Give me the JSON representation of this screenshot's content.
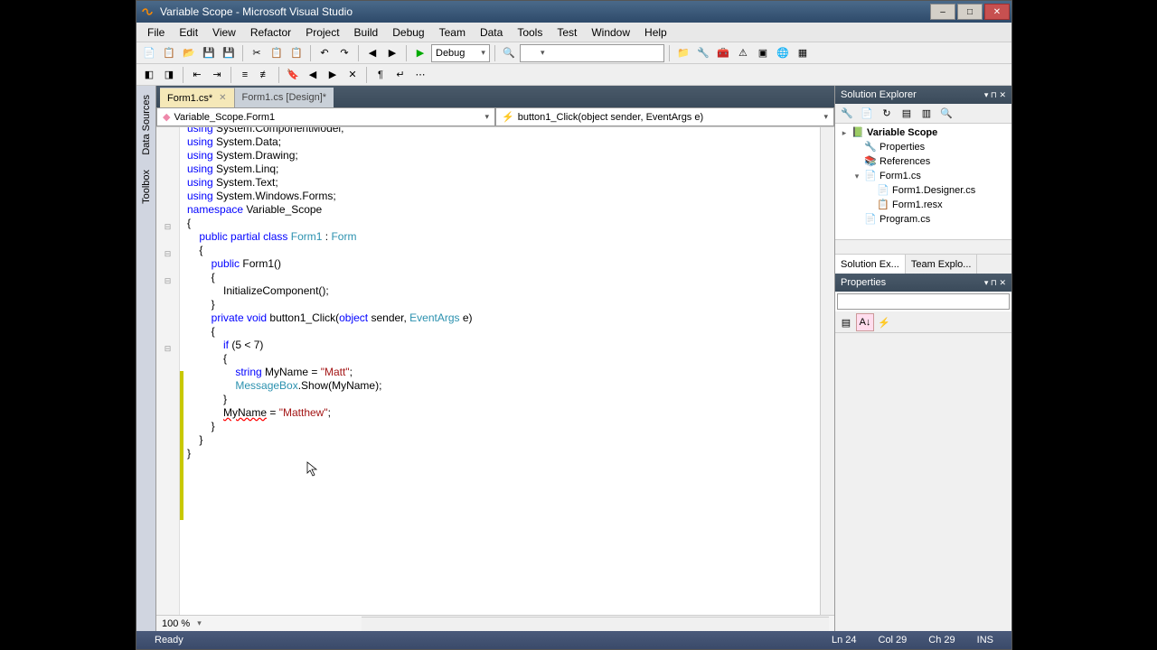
{
  "titlebar": {
    "app_icon": "∞",
    "title": "Variable Scope - Microsoft Visual Studio"
  },
  "menu": [
    "File",
    "Edit",
    "View",
    "Refactor",
    "Project",
    "Build",
    "Debug",
    "Team",
    "Data",
    "Tools",
    "Test",
    "Window",
    "Help"
  ],
  "toolbar1_config": "Debug",
  "tabs": [
    {
      "label": "Form1.cs*",
      "active": true
    },
    {
      "label": "Form1.cs [Design]*",
      "active": false
    }
  ],
  "combo_left": "Variable_Scope.Form1",
  "combo_right": "button1_Click(object sender, EventArgs e)",
  "code_lines": [
    {
      "i": 0,
      "t": [
        [
          "k",
          "using"
        ],
        [
          "",
          " System.ComponentModel;"
        ]
      ],
      "clip": true
    },
    {
      "i": 0,
      "t": [
        [
          "k",
          "using"
        ],
        [
          "",
          " System.Data;"
        ]
      ]
    },
    {
      "i": 0,
      "t": [
        [
          "k",
          "using"
        ],
        [
          "",
          " System.Drawing;"
        ]
      ]
    },
    {
      "i": 0,
      "t": [
        [
          "k",
          "using"
        ],
        [
          "",
          " System.Linq;"
        ]
      ]
    },
    {
      "i": 0,
      "t": [
        [
          "k",
          "using"
        ],
        [
          "",
          " System.Text;"
        ]
      ]
    },
    {
      "i": 0,
      "t": [
        [
          "k",
          "using"
        ],
        [
          "",
          " System.Windows.Forms;"
        ]
      ]
    },
    {
      "i": 0,
      "t": [
        [
          "",
          ""
        ]
      ]
    },
    {
      "i": 0,
      "t": [
        [
          "k",
          "namespace"
        ],
        [
          "",
          " Variable_Scope"
        ]
      ],
      "fold": "-"
    },
    {
      "i": 0,
      "t": [
        [
          "",
          "{"
        ]
      ]
    },
    {
      "i": 1,
      "t": [
        [
          "k",
          "public"
        ],
        [
          "",
          " "
        ],
        [
          "k",
          "partial"
        ],
        [
          "",
          " "
        ],
        [
          "k",
          "class"
        ],
        [
          "",
          " "
        ],
        [
          "t",
          "Form1"
        ],
        [
          "",
          " : "
        ],
        [
          "t",
          "Form"
        ]
      ],
      "fold": "-"
    },
    {
      "i": 1,
      "t": [
        [
          "",
          "{"
        ]
      ]
    },
    {
      "i": 2,
      "t": [
        [
          "k",
          "public"
        ],
        [
          "",
          " Form1()"
        ]
      ],
      "fold": "-"
    },
    {
      "i": 2,
      "t": [
        [
          "",
          "{"
        ]
      ]
    },
    {
      "i": 3,
      "t": [
        [
          "",
          "InitializeComponent();"
        ]
      ]
    },
    {
      "i": 2,
      "t": [
        [
          "",
          "}"
        ]
      ]
    },
    {
      "i": 0,
      "t": [
        [
          "",
          ""
        ]
      ]
    },
    {
      "i": 2,
      "t": [
        [
          "k",
          "private"
        ],
        [
          "",
          " "
        ],
        [
          "k",
          "void"
        ],
        [
          "",
          " button1_Click("
        ],
        [
          "k",
          "object"
        ],
        [
          "",
          " sender, "
        ],
        [
          "t",
          "EventArgs"
        ],
        [
          "",
          " e)"
        ]
      ],
      "fold": "-"
    },
    {
      "i": 2,
      "t": [
        [
          "",
          "{"
        ]
      ]
    },
    {
      "i": 3,
      "t": [
        [
          "k",
          "if"
        ],
        [
          "",
          " (5 < 7)"
        ]
      ],
      "ch": true
    },
    {
      "i": 3,
      "t": [
        [
          "",
          "{"
        ]
      ],
      "ch": true
    },
    {
      "i": 4,
      "t": [
        [
          "k",
          "string"
        ],
        [
          "",
          " MyName = "
        ],
        [
          "s",
          "\"Matt\""
        ],
        [
          "",
          ";"
        ]
      ],
      "ch": true
    },
    {
      "i": 4,
      "t": [
        [
          "t",
          "MessageBox"
        ],
        [
          "",
          ".Show(MyName);"
        ]
      ],
      "ch": true
    },
    {
      "i": 3,
      "t": [
        [
          "",
          "}"
        ]
      ],
      "ch": true
    },
    {
      "i": 0,
      "t": [
        [
          "",
          ""
        ]
      ],
      "ch": true
    },
    {
      "i": 3,
      "t": [
        [
          "err",
          "MyName"
        ],
        [
          "",
          " = "
        ],
        [
          "s",
          "\"Matthew\""
        ],
        [
          "",
          ";"
        ]
      ],
      "ch": true
    },
    {
      "i": 0,
      "t": [
        [
          "",
          ""
        ]
      ],
      "ch": true
    },
    {
      "i": 0,
      "t": [
        [
          "",
          ""
        ]
      ],
      "ch": true
    },
    {
      "i": 0,
      "t": [
        [
          "",
          ""
        ]
      ],
      "ch": true
    },
    {
      "i": 0,
      "t": [
        [
          "",
          ""
        ]
      ],
      "ch": true
    },
    {
      "i": 2,
      "t": [
        [
          "",
          "}"
        ]
      ]
    },
    {
      "i": 1,
      "t": [
        [
          "",
          "}"
        ]
      ]
    },
    {
      "i": 0,
      "t": [
        [
          "",
          "}"
        ]
      ]
    }
  ],
  "editor_zoom": "100 %",
  "sidebar_labels": {
    "datasources": "Data Sources",
    "toolbox": "Toolbox"
  },
  "solution_explorer": {
    "title": "Solution Explorer",
    "nodes": [
      {
        "depth": 0,
        "tw": "▸",
        "ico": "sln",
        "label": "Variable Scope",
        "bold": true
      },
      {
        "depth": 1,
        "tw": "",
        "ico": "prop",
        "label": "Properties"
      },
      {
        "depth": 1,
        "tw": "",
        "ico": "ref",
        "label": "References"
      },
      {
        "depth": 1,
        "tw": "▾",
        "ico": "cs",
        "label": "Form1.cs"
      },
      {
        "depth": 2,
        "tw": "",
        "ico": "cs",
        "label": "Form1.Designer.cs"
      },
      {
        "depth": 2,
        "tw": "",
        "ico": "rx",
        "label": "Form1.resx"
      },
      {
        "depth": 1,
        "tw": "",
        "ico": "cs",
        "label": "Program.cs"
      }
    ]
  },
  "panel_tabs": [
    {
      "label": "Solution Ex...",
      "active": true
    },
    {
      "label": "Team Explo...",
      "active": false
    }
  ],
  "properties": {
    "title": "Properties"
  },
  "statusbar": {
    "ready": "Ready",
    "ln": "Ln 24",
    "col": "Col 29",
    "ch": "Ch 29",
    "ins": "INS"
  }
}
